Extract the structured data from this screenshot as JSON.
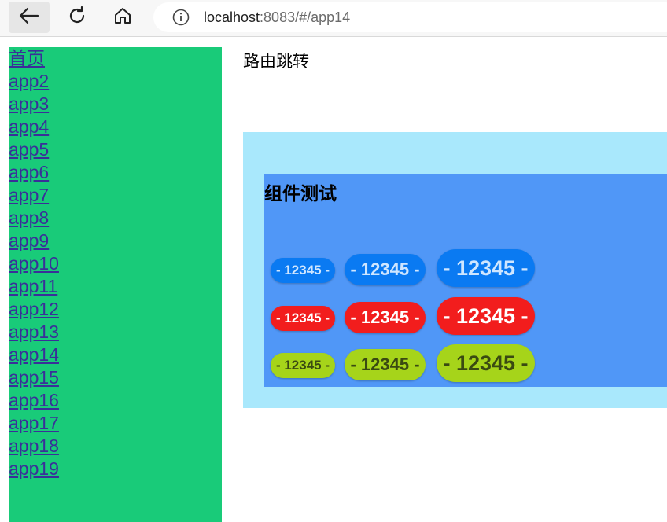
{
  "browser": {
    "url_host": "localhost",
    "url_rest": ":8083/#/app14",
    "icons": [
      "back-arrow-icon",
      "reload-icon",
      "home-icon",
      "info-icon"
    ]
  },
  "sidebar": {
    "links": [
      "首页",
      "app2",
      "app3",
      "app4",
      "app5",
      "app6",
      "app7",
      "app8",
      "app9",
      "app10",
      "app11",
      "app12",
      "app13",
      "app14",
      "app15",
      "app16",
      "app17",
      "app18",
      "app19"
    ]
  },
  "main": {
    "title": "路由跳转",
    "component_title": "组件测试",
    "buttons": {
      "blue": [
        "- 12345 -",
        "- 12345 -",
        "- 12345 -"
      ],
      "red": [
        "- 12345 -",
        "- 12345 -",
        "- 12345 -"
      ],
      "green": [
        "- 12345 -",
        "- 12345 -",
        "- 12345 -"
      ]
    }
  },
  "colors": {
    "sidebar_bg": "#19cb79",
    "outer_panel": "#a9e8fc",
    "inner_panel": "#5097f7",
    "blue_button": "#0a7af2",
    "red_button": "#f21d1d",
    "green_button": "#a6d41a",
    "link": "#3a2f99"
  }
}
